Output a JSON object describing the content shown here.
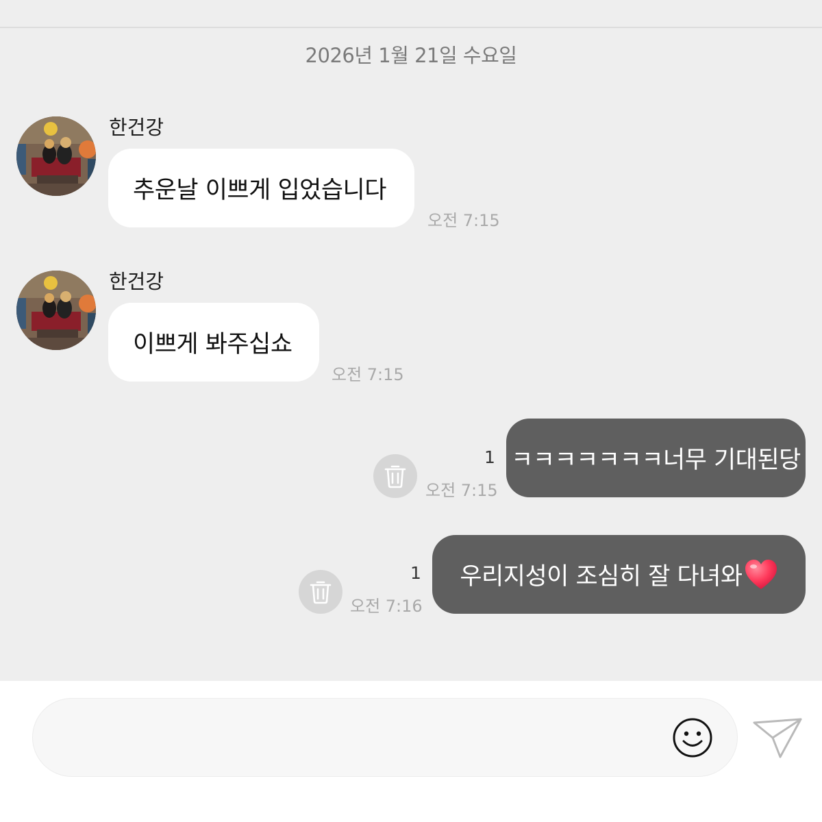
{
  "date_separator": "2026년 1월 21일 수요일",
  "messages": [
    {
      "direction": "incoming",
      "sender": "한건강",
      "text": "추운날 이쁘게 입었습니다",
      "time": "오전 7:15"
    },
    {
      "direction": "incoming",
      "sender": "한건강",
      "text": "이쁘게 봐주십쇼",
      "time": "오전 7:15"
    },
    {
      "direction": "outgoing",
      "text": "ㅋㅋㅋㅋㅋㅋㅋ너무 기대된당",
      "time": "오전 7:15",
      "unread_count": "1",
      "action_icon": "trash-icon"
    },
    {
      "direction": "outgoing",
      "text": "우리지성이 조심히 잘 다녀와",
      "emoji": "red-heart",
      "time": "오전 7:16",
      "unread_count": "1",
      "action_icon": "trash-icon"
    }
  ],
  "composer": {
    "placeholder": "",
    "value": "",
    "emoji_icon": "smiley-icon",
    "send_icon": "paper-plane-icon"
  },
  "colors": {
    "chat_background": "#eeeeee",
    "incoming_bubble": "#ffffff",
    "outgoing_bubble": "#5f5f5f",
    "timestamp": "#a9a9a9",
    "heart": "#ff3b5c"
  }
}
